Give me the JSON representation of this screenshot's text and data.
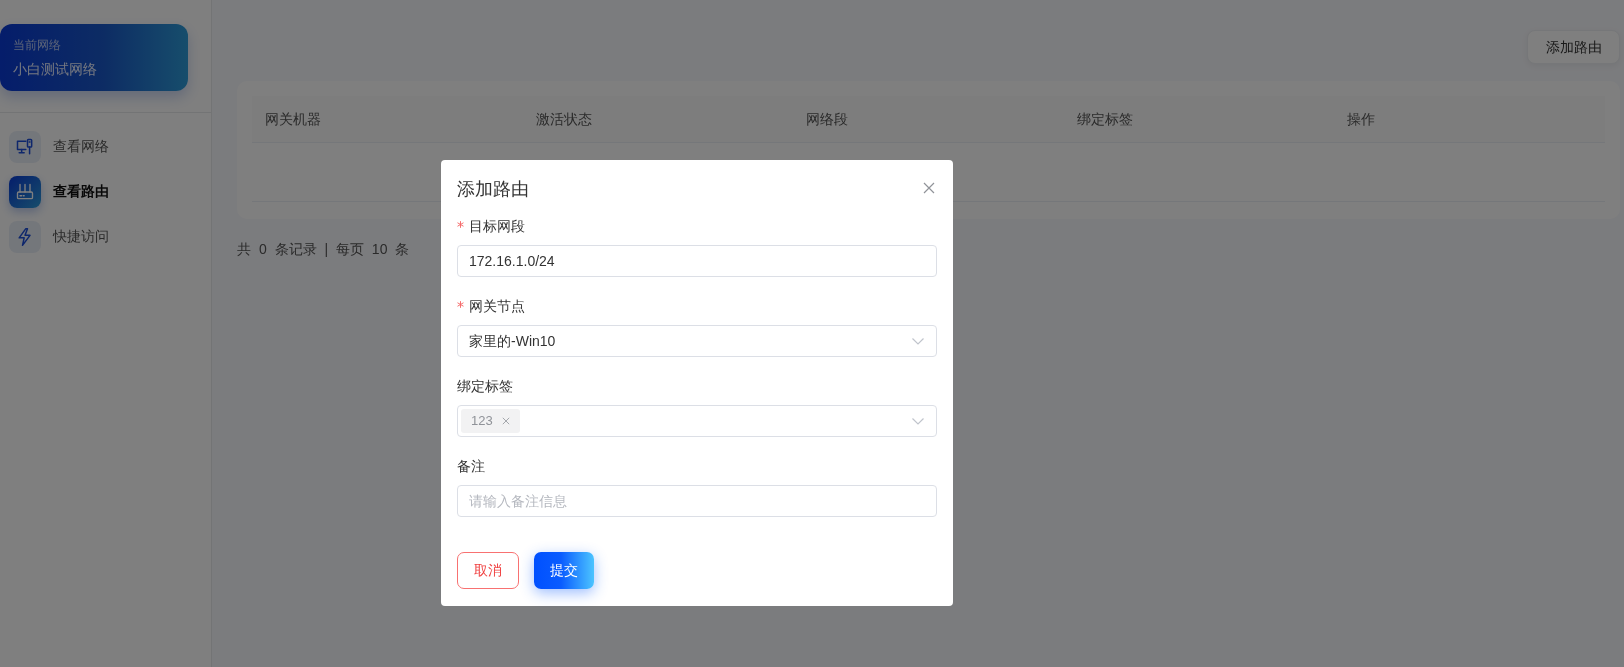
{
  "sidebar": {
    "network_card": {
      "label": "当前网络",
      "name": "小白测试网络"
    },
    "items": [
      {
        "label": "查看网络",
        "selected": false
      },
      {
        "label": "查看路由",
        "selected": true
      },
      {
        "label": "快捷访问",
        "selected": false
      }
    ]
  },
  "toolbar": {
    "add_button": "添加路由"
  },
  "table": {
    "columns": [
      "网关机器",
      "激活状态",
      "网络段",
      "绑定标签",
      "操作"
    ]
  },
  "pagination": "共 0 条记录 | 每页 10 条",
  "dialog": {
    "title": "添加路由",
    "fields": [
      {
        "label": "目标网段",
        "required": true,
        "kind": "input",
        "value": "172.16.1.0/24"
      },
      {
        "label": "网关节点",
        "required": true,
        "kind": "select",
        "value": "家里的-Win10"
      },
      {
        "label": "绑定标签",
        "required": false,
        "kind": "tags",
        "tags": [
          "123"
        ]
      },
      {
        "label": "备注",
        "required": false,
        "kind": "input",
        "placeholder": "请输入备注信息"
      }
    ],
    "buttons": [
      {
        "label": "取消",
        "kind": "secondary"
      },
      {
        "label": "提交",
        "kind": "primary"
      }
    ]
  }
}
